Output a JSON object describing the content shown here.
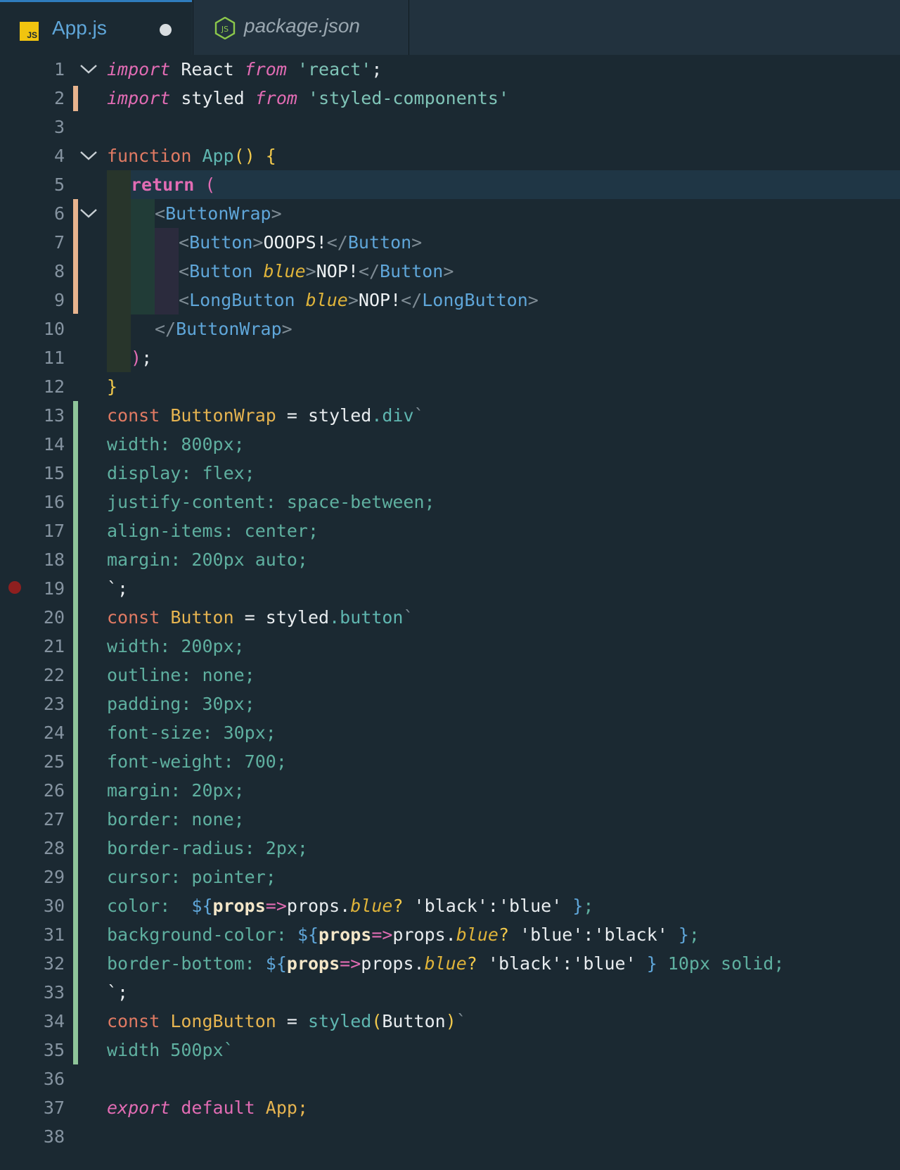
{
  "tabs": [
    {
      "label": "App.js",
      "icon": "js-file-icon",
      "active": true,
      "modified": true
    },
    {
      "label": "package.json",
      "icon": "nodejs-icon",
      "active": false
    }
  ],
  "line_numbers": [
    "1",
    "2",
    "3",
    "4",
    "5",
    "6",
    "7",
    "8",
    "9",
    "10",
    "11",
    "12",
    "13",
    "14",
    "15",
    "16",
    "17",
    "18",
    "19",
    "20",
    "21",
    "22",
    "23",
    "24",
    "25",
    "26",
    "27",
    "28",
    "29",
    "30",
    "31",
    "32",
    "33",
    "34",
    "35",
    "36",
    "37",
    "38"
  ],
  "code": {
    "l1": [
      "import",
      " React ",
      "from",
      " ",
      "'react'",
      ";"
    ],
    "l2": [
      "import",
      " styled ",
      "from",
      " ",
      "'styled-components'"
    ],
    "l4": [
      "function",
      " ",
      "App",
      "()",
      " {"
    ],
    "l5": [
      "return",
      " ("
    ],
    "l6": [
      "<",
      "ButtonWrap",
      ">"
    ],
    "l7": [
      "<",
      "Button",
      ">",
      "OOOPS!",
      "</",
      "Button",
      ">"
    ],
    "l8": [
      "<",
      "Button",
      " ",
      "blue",
      ">",
      "NOP!",
      "</",
      "Button",
      ">"
    ],
    "l9": [
      "<",
      "LongButton",
      " ",
      "blue",
      ">",
      "NOP!",
      "</",
      "LongButton",
      ">"
    ],
    "l10": [
      "</",
      "ButtonWrap",
      ">"
    ],
    "l11": [
      ")",
      ";"
    ],
    "l12": [
      "}"
    ],
    "l13": [
      "const",
      " ",
      "ButtonWrap",
      " = ",
      "styled",
      ".",
      "div",
      "`"
    ],
    "l14": "width: 800px;",
    "l15": "display: flex;",
    "l16": "justify-content: space-between;",
    "l17": "align-items: center;",
    "l18": "margin: 200px auto;",
    "l19": "`;",
    "l20": [
      "const",
      " ",
      "Button",
      " = ",
      "styled",
      ".",
      "button",
      "`"
    ],
    "l21": "width: 200px;",
    "l22": "outline: none;",
    "l23": "padding: 30px;",
    "l24": "font-size: 30px;",
    "l25": "font-weight: 700;",
    "l26": "margin: 20px;",
    "l27": "border: none;",
    "l28": "border-radius: 2px;",
    "l29": "cursor: pointer;",
    "l30": [
      "color:  ",
      "${",
      "props",
      "=>",
      "props.",
      "blue",
      "? ",
      "'black'",
      ":",
      "'blue'",
      " }",
      ";"
    ],
    "l31": [
      "background-color: ",
      "${",
      "props",
      "=>",
      "props.",
      "blue",
      "? ",
      "'blue'",
      ":",
      "'black'",
      " }",
      ";"
    ],
    "l32": [
      "border-bottom: ",
      "${",
      "props",
      "=>",
      "props.",
      "blue",
      "? ",
      "'black'",
      ":",
      "'blue'",
      " }",
      " 10px solid;"
    ],
    "l33": "`;",
    "l34": [
      "const",
      " ",
      "LongButton",
      " = ",
      "styled",
      "(",
      "Button",
      ")",
      "`"
    ],
    "l35": "width 500px`",
    "l37": [
      "export",
      " ",
      "default",
      " App;"
    ]
  },
  "colors": {
    "background": "#1b2932",
    "git_modified": "#e8b48e",
    "git_added": "#8fc59a",
    "breakpoint": "#8e1f1f",
    "accent": "#2f7cbd"
  }
}
